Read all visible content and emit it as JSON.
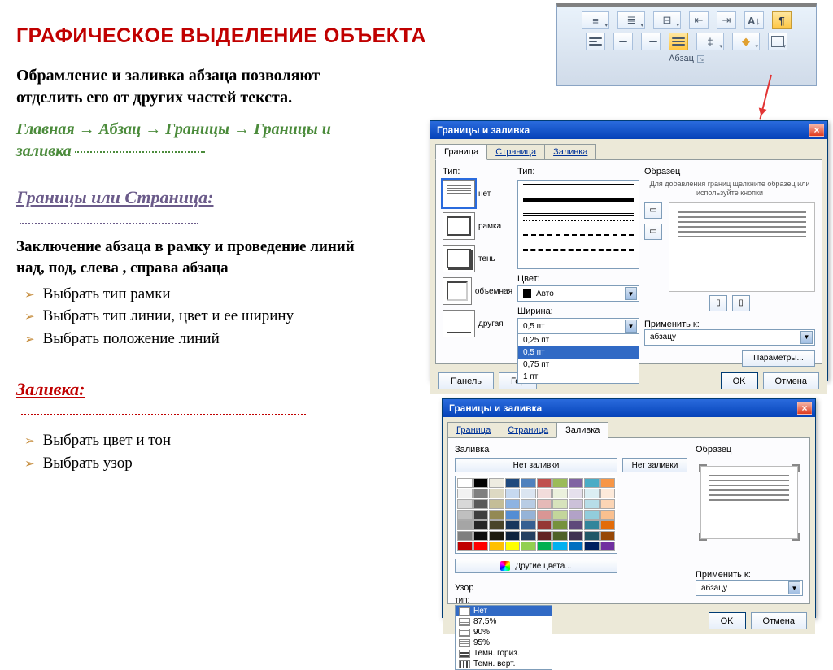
{
  "heading": "ГРАФИЧЕСКОЕ ВЫДЕЛЕНИЕ ОБЪЕКТА",
  "intro": "Обрамление и заливка абзаца позволяют отделить его от других частей текста.",
  "nav_path": "Главная → Абзац → Границы → Границы и заливка",
  "section1": {
    "title": "Границы или Страница:",
    "desc": "Заключение абзаца в рамку и проведение линий над, под, слева , справа абзаца",
    "bullets": [
      "Выбрать тип рамки",
      "Выбрать тип линии, цвет и ее ширину",
      "Выбрать положение линий"
    ]
  },
  "section2": {
    "title": "Заливка:",
    "bullets": [
      "Выбрать цвет и тон",
      "Выбрать узор"
    ]
  },
  "ribbon": {
    "group": "Абзац"
  },
  "dlg1": {
    "title": "Границы и заливка",
    "tabs": [
      "Граница",
      "Страница",
      "Заливка"
    ],
    "lbl_type": "Тип:",
    "types": [
      "нет",
      "рамка",
      "тень",
      "объемная",
      "другая"
    ],
    "lbl_style": "Тип:",
    "lbl_color": "Цвет:",
    "color_value": "Авто",
    "lbl_width": "Ширина:",
    "width_value": "0,5 пт",
    "width_options": [
      "0,25 пт",
      "0,5 пт",
      "0,75 пт",
      "1 пт"
    ],
    "lbl_preview": "Образец",
    "preview_hint": "Для добавления границ щелкните образец или используйте кнопки",
    "lbl_applyto": "Применить к:",
    "applyto_value": "абзацу",
    "btn_params": "Параметры...",
    "btn_panel": "Панель",
    "btn_hline": "Гор",
    "btn_ok": "OK",
    "btn_cancel": "Отмена"
  },
  "dlg2": {
    "title": "Границы и заливка",
    "tabs": [
      "Граница",
      "Страница",
      "Заливка"
    ],
    "lbl_fill": "Заливка",
    "nofill": "Нет заливки",
    "nofill_side": "Нет заливки",
    "more_colors": "Другие цвета...",
    "lbl_pattern": "Узор",
    "lbl_pattern_type": "тип:",
    "patterns": [
      "Нет",
      "87,5%",
      "90%",
      "95%",
      "Темн. гориз.",
      "Темн. верт."
    ],
    "lbl_preview": "Образец",
    "lbl_applyto": "Применить к:",
    "applyto_value": "абзацу",
    "btn_ok": "OK",
    "btn_cancel": "Отмена"
  },
  "palette": [
    "#ffffff",
    "#000000",
    "#eeece1",
    "#1f497d",
    "#4f81bd",
    "#c0504d",
    "#9bbb59",
    "#8064a2",
    "#4bacc6",
    "#f79646",
    "#f2f2f2",
    "#7f7f7f",
    "#ddd9c3",
    "#c6d9f0",
    "#dbe5f1",
    "#f2dcdb",
    "#ebf1dd",
    "#e5e0ec",
    "#dbeef3",
    "#fdeada",
    "#d8d8d8",
    "#595959",
    "#c4bd97",
    "#8db3e2",
    "#b8cce4",
    "#e5b9b7",
    "#d7e3bc",
    "#ccc1d9",
    "#b7dde8",
    "#fbd5b5",
    "#bfbfbf",
    "#3f3f3f",
    "#938953",
    "#548dd4",
    "#95b3d7",
    "#d99694",
    "#c3d69b",
    "#b2a2c7",
    "#92cddc",
    "#fac08f",
    "#a5a5a5",
    "#262626",
    "#494429",
    "#17365d",
    "#366092",
    "#953734",
    "#76923c",
    "#5f497a",
    "#31859b",
    "#e36c09",
    "#7f7f7f",
    "#0c0c0c",
    "#1d1b10",
    "#0f243e",
    "#244061",
    "#632423",
    "#4f6128",
    "#3f3151",
    "#205867",
    "#974806",
    "#c00000",
    "#ff0000",
    "#ffc000",
    "#ffff00",
    "#92d050",
    "#00b050",
    "#00b0f0",
    "#0070c0",
    "#002060",
    "#7030a0"
  ]
}
